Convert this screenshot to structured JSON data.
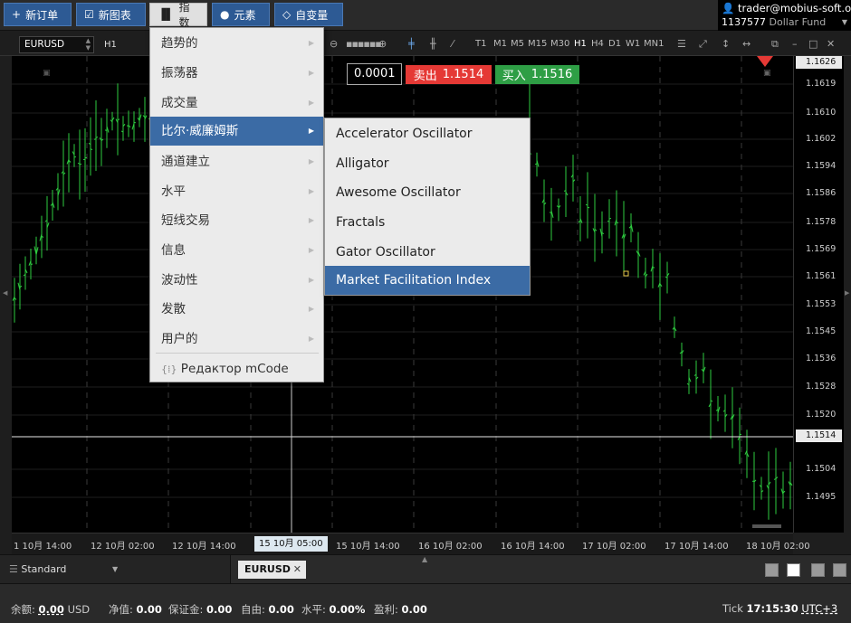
{
  "toolbar": {
    "new_order": "新订单",
    "new_chart": "新图表",
    "indicators": "指数",
    "elements": "元素",
    "variables": "自变量"
  },
  "account": {
    "email": "trader@mobius-soft.org",
    "number": "1137577",
    "fund": "Dollar Fund"
  },
  "chart_toolbar": {
    "symbol": "EURUSD",
    "timeframe": "H1",
    "timeframes": [
      "T1",
      "M1",
      "M5",
      "M15",
      "M30",
      "H1",
      "H4",
      "D1",
      "W1",
      "MN1"
    ],
    "selected_timeframe": "H1"
  },
  "trade": {
    "lot": "0.0001",
    "sell_label": "卖出",
    "sell_price": "1.1514",
    "buy_label": "买入",
    "buy_price": "1.1516"
  },
  "indicator_menu": {
    "items": [
      "趋势的",
      "振荡器",
      "成交量",
      "比尔·威廉姆斯",
      "通道建立",
      "水平",
      "短线交易",
      "信息",
      "波动性",
      "发散",
      "用户的"
    ],
    "selected": "比尔·威廉姆斯",
    "editor": "Редактор mCode"
  },
  "bill_williams_submenu": {
    "items": [
      "Accelerator Oscillator",
      "Alligator",
      "Awesome Oscillator",
      "Fractals",
      "Gator Oscillator",
      "Market Facilitation Index"
    ],
    "selected": "Market Facilitation Index"
  },
  "price_scale": {
    "labels": [
      "1.1619",
      "1.1610",
      "1.1602",
      "1.1594",
      "1.1586",
      "1.1578",
      "1.1569",
      "1.1561",
      "1.1553",
      "1.1545",
      "1.1536",
      "1.1528",
      "1.1520",
      "1.1504",
      "1.1495"
    ],
    "top_box": "1.1626",
    "current_box": "1.1514"
  },
  "time_scale": {
    "labels": [
      "1 10月 14:00",
      "12 10月 02:00",
      "12 10月 14:00",
      "15 10月 05:00",
      "15 10月 14:00",
      "16 10月 02:00",
      "16 10月 14:00",
      "17 10月 02:00",
      "17 10月 14:00",
      "18 10月 02:00"
    ],
    "cursor_label": "15 10月 05:00"
  },
  "bottom": {
    "workspace": "Standard",
    "symbol_tab": "EURUSD"
  },
  "status": {
    "balance_label": "余额:",
    "balance_value": "0.00",
    "balance_currency": "USD",
    "equity_label": "净值:",
    "equity_value": "0.00",
    "margin_label": "保证金:",
    "margin_value": "0.00",
    "free_label": "自由:",
    "free_value": "0.00",
    "level_label": "水平:",
    "level_value": "0.00%",
    "profit_label": "盈利:",
    "profit_value": "0.00",
    "tick_label": "Tick",
    "time": "17:15:30",
    "timezone": "UTC+3"
  },
  "colors": {
    "candle": "#2ecc40",
    "sell": "#e53935",
    "buy": "#2e9e45",
    "menu_selected": "#3b6ba5",
    "toolbar_button": "#2d5a94"
  }
}
